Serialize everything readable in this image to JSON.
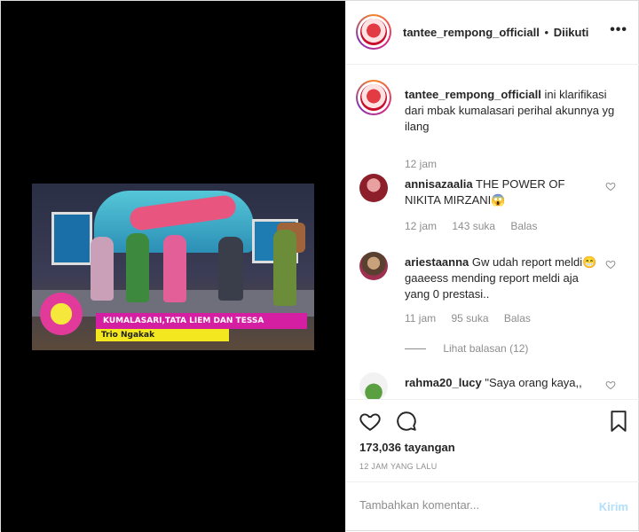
{
  "post": {
    "username": "tantee_rempong_officiall",
    "separator": "•",
    "follow_status": "Diikuti",
    "more": "•••"
  },
  "video": {
    "lower_third": "KUMALASARI,TATA LIEM DAN TESSA MARISKA",
    "sub_title": "Trio Ngakak"
  },
  "caption": {
    "username": "tantee_rempong_officiall",
    "text": "ini klarifikasi dari mbak kumalasari perihal akunnya yg ilang",
    "time": "12 jam"
  },
  "comments": [
    {
      "username": "annisazaalia",
      "text": "THE POWER OF NIKITA MIRZANI😱",
      "time": "12 jam",
      "likes": "143 suka",
      "reply": "Balas"
    },
    {
      "username": "ariestaanna",
      "text": "Gw udah report meldi😁 gaaeess mending report meldi aja yang 0 prestasi..",
      "time": "11 jam",
      "likes": "95 suka",
      "reply": "Balas",
      "view_replies": "Lihat balasan (12)"
    },
    {
      "username": "rahma20_lucy",
      "text": "\"Saya orang kaya,,"
    }
  ],
  "actions": {
    "views": "173,036 tayangan",
    "posted_ago": "12 JAM YANG LALU"
  },
  "compose": {
    "placeholder": "Tambahkan komentar...",
    "post_label": "Kirim"
  },
  "colors": {
    "post_button_disabled": "#b2dffc",
    "muted_text": "#8e8e8e"
  }
}
